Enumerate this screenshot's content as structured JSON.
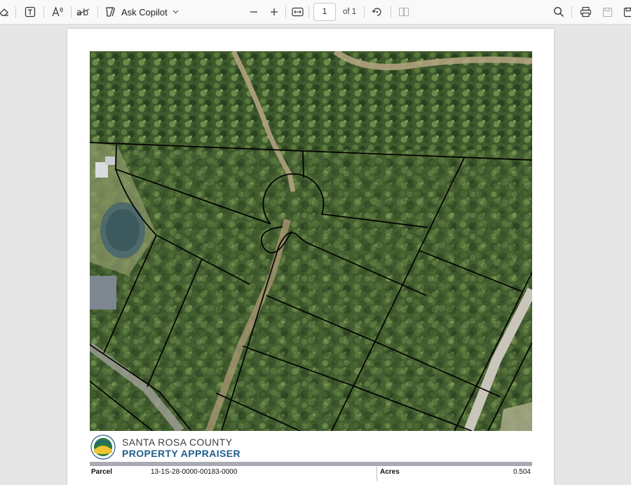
{
  "toolbar": {
    "copilot_label": "Ask Copilot",
    "current_page": "1",
    "page_of": "of 1",
    "icons": [
      "eraser-icon",
      "text-box-icon",
      "read-aloud-icon",
      "translate-icon",
      "copilot-icon",
      "chevron-down-icon",
      "zoom-out-icon",
      "zoom-in-icon",
      "fit-width-icon",
      "rotate-icon",
      "page-view-icon",
      "search-icon",
      "print-icon",
      "save-icon",
      "save-as-icon"
    ]
  },
  "document": {
    "org_name": "SANTA ROSA COUNTY",
    "org_subtitle": "PROPERTY APPRAISER",
    "parcel_label": "Parcel",
    "parcel_value": "13-1S-28-0000-00183-0000",
    "acres_label": "Acres",
    "acres_value": "0.504",
    "brand_colors": {
      "title": "#1f5f8b",
      "bar": "#a9aab2",
      "parcel_lines": "#000000"
    }
  }
}
